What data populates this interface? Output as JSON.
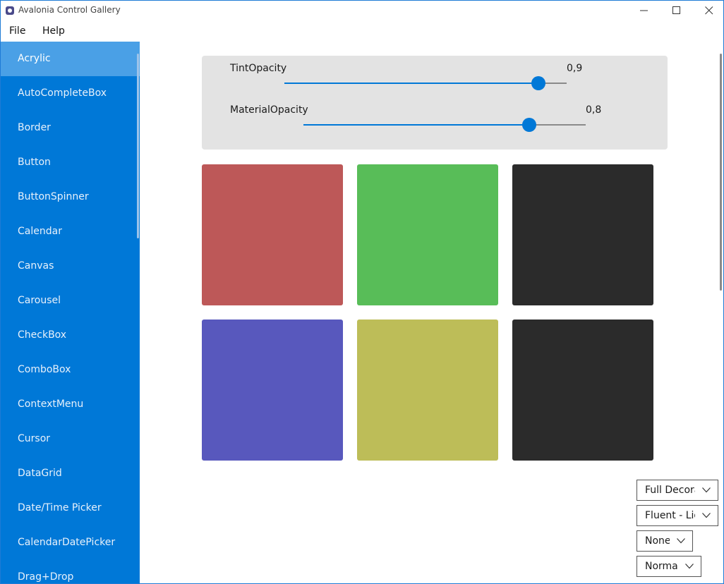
{
  "window": {
    "title": "Avalonia Control Gallery"
  },
  "menu": {
    "file": "File",
    "help": "Help"
  },
  "sidebar": {
    "items": [
      {
        "label": "Acrylic"
      },
      {
        "label": "AutoCompleteBox"
      },
      {
        "label": "Border"
      },
      {
        "label": "Button"
      },
      {
        "label": "ButtonSpinner"
      },
      {
        "label": "Calendar"
      },
      {
        "label": "Canvas"
      },
      {
        "label": "Carousel"
      },
      {
        "label": "CheckBox"
      },
      {
        "label": "ComboBox"
      },
      {
        "label": "ContextMenu"
      },
      {
        "label": "Cursor"
      },
      {
        "label": "DataGrid"
      },
      {
        "label": "Date/Time Picker"
      },
      {
        "label": "CalendarDatePicker"
      },
      {
        "label": "Drag+Drop"
      }
    ],
    "selected": "Acrylic"
  },
  "acrylic": {
    "tint": {
      "label": "TintOpacity",
      "value_text": "0,9",
      "value": 0.9
    },
    "material": {
      "label": "MaterialOpacity",
      "value_text": "0,8",
      "value": 0.8
    },
    "swatches": [
      {
        "name": "red",
        "color": "#bd5858"
      },
      {
        "name": "green",
        "color": "#58bd58"
      },
      {
        "name": "black",
        "color": "#2b2b2b"
      },
      {
        "name": "blue",
        "color": "#5858bd"
      },
      {
        "name": "yellow",
        "color": "#bdbd58"
      },
      {
        "name": "black",
        "color": "#2b2b2b"
      }
    ]
  },
  "options": {
    "decorations": "Full Decora",
    "theme": "Fluent - Lig",
    "transparency": "None",
    "flow": "Normal"
  },
  "colors": {
    "accent": "#0078d7",
    "accent_selected": "#4aa0e6"
  },
  "icons": [
    "app-icon",
    "minimize-icon",
    "maximize-icon",
    "close-icon",
    "chevron-down-icon"
  ]
}
